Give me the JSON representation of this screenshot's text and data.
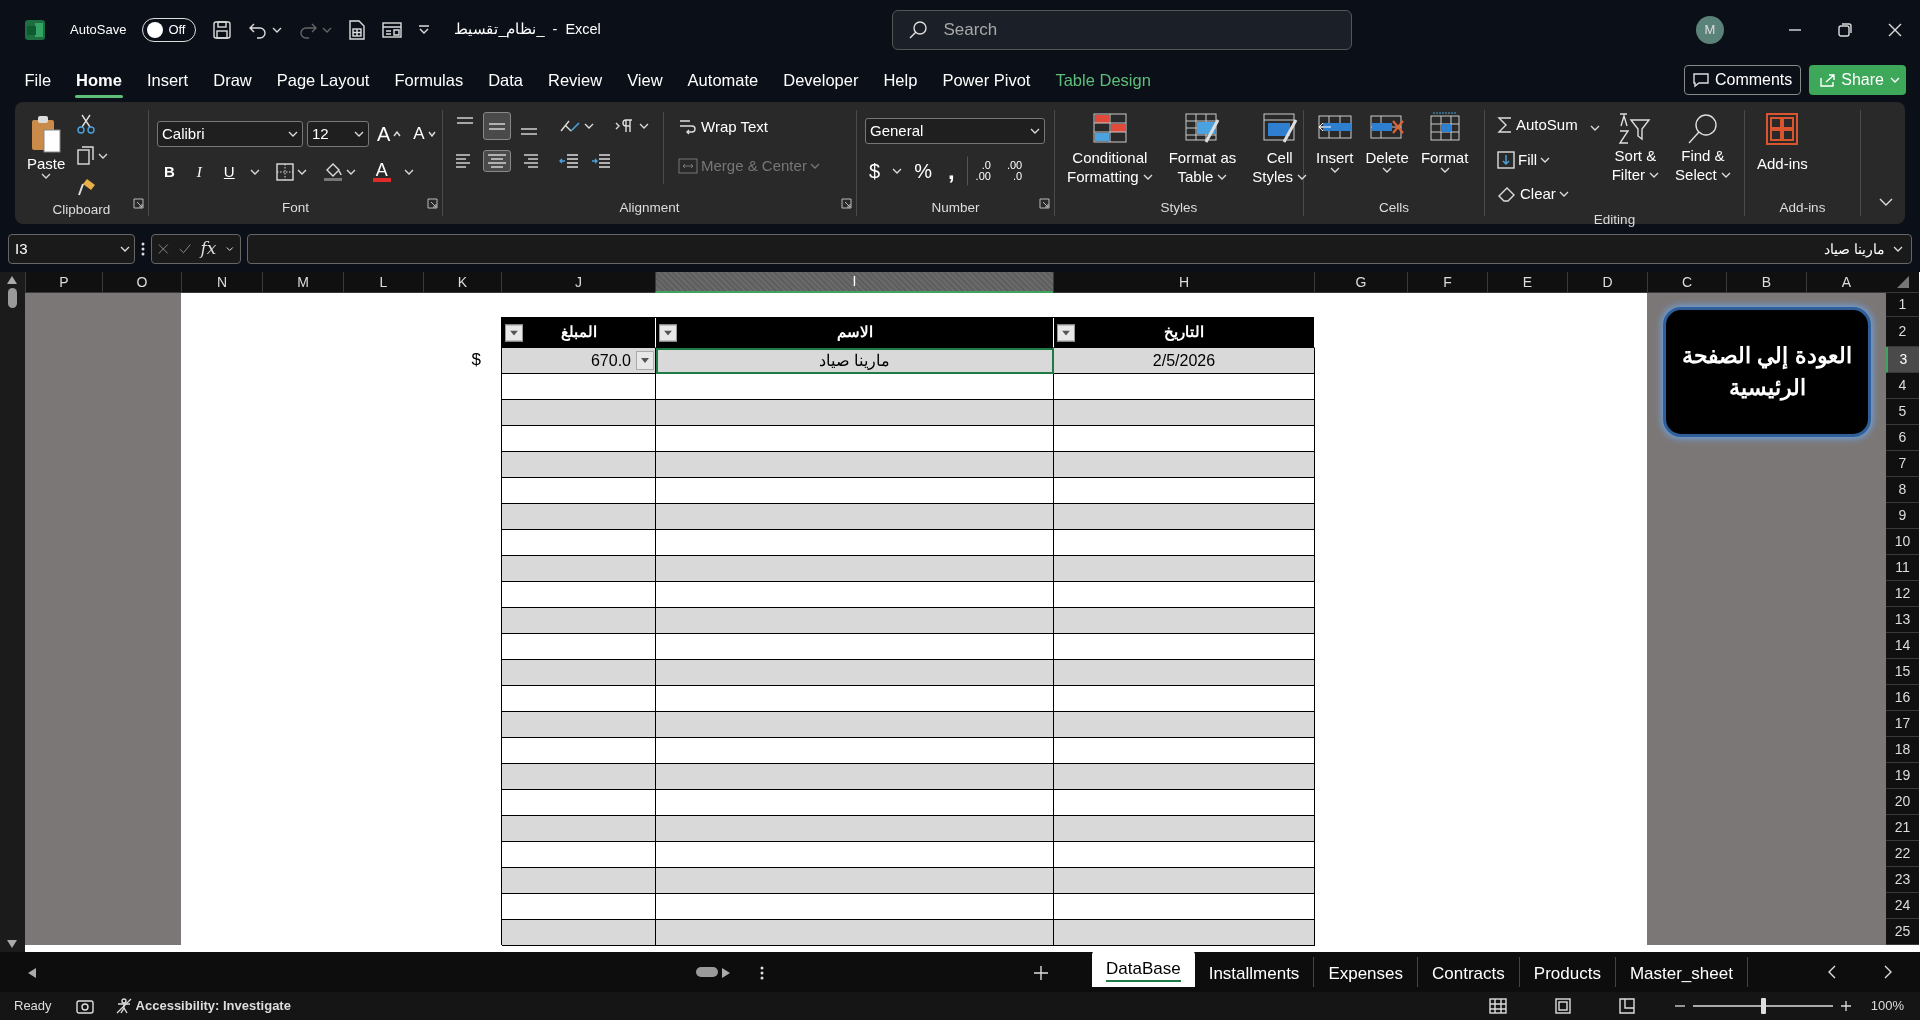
{
  "window": {
    "file_name": "نظام_تقسيط_",
    "separator": "-",
    "app": "Excel",
    "autosave": "AutoSave",
    "autosave_on": false,
    "autosave_state": "Off",
    "search_placeholder": "Search",
    "avatar": "M"
  },
  "tabs": [
    {
      "label": "File",
      "selected": false,
      "kind": "normal"
    },
    {
      "label": "Home",
      "selected": true,
      "kind": "normal"
    },
    {
      "label": "Insert",
      "selected": false,
      "kind": "normal"
    },
    {
      "label": "Draw",
      "selected": false,
      "kind": "normal"
    },
    {
      "label": "Page Layout",
      "selected": false,
      "kind": "normal"
    },
    {
      "label": "Formulas",
      "selected": false,
      "kind": "normal"
    },
    {
      "label": "Data",
      "selected": false,
      "kind": "normal"
    },
    {
      "label": "Review",
      "selected": false,
      "kind": "normal"
    },
    {
      "label": "View",
      "selected": false,
      "kind": "normal"
    },
    {
      "label": "Automate",
      "selected": false,
      "kind": "normal"
    },
    {
      "label": "Developer",
      "selected": false,
      "kind": "normal"
    },
    {
      "label": "Help",
      "selected": false,
      "kind": "normal"
    },
    {
      "label": "Power Pivot",
      "selected": false,
      "kind": "normal"
    },
    {
      "label": "Table Design",
      "selected": false,
      "kind": "contextual"
    }
  ],
  "comments": "Comments",
  "share": "Share",
  "clipboard": {
    "label": "Clipboard",
    "paste": "Paste"
  },
  "font": {
    "label": "Font",
    "font_name": "Calibri",
    "font_size": "12",
    "grow": "A",
    "shrink": "A",
    "bold": "B",
    "italic": "I",
    "underline": "U",
    "font_color": "A"
  },
  "alignment": {
    "label": "Alignment",
    "vertical_align": [
      {
        "selected": false
      },
      {
        "selected": true
      },
      {
        "selected": false
      }
    ],
    "horizontal_align": [
      {
        "selected": false
      },
      {
        "selected": true
      },
      {
        "selected": false
      }
    ],
    "wrap_text": "Wrap Text",
    "merge": "Merge & Center",
    "merge_disabled": true
  },
  "number": {
    "label": "Number",
    "format": "General",
    "currency": "$",
    "percent": "%",
    "comma": ",",
    "decimals": [
      {
        "top": ".0",
        "bottom": ".00"
      },
      {
        "top": ".00",
        "bottom": ".0"
      }
    ]
  },
  "styles": {
    "label": "Styles",
    "buttons": [
      {
        "lines": [
          "Conditional",
          "Formatting"
        ]
      },
      {
        "lines": [
          "Format as",
          "Table"
        ]
      },
      {
        "lines": [
          "Cell",
          "Styles"
        ]
      }
    ]
  },
  "cells": {
    "label": "Cells",
    "buttons": [
      "Insert",
      "Delete",
      "Format"
    ]
  },
  "editing": {
    "label": "Editing",
    "autosum": "AutoSum",
    "fill": "Fill",
    "clear": "Clear",
    "sort": [
      "Sort &",
      "Filter"
    ],
    "find": [
      "Find &",
      "Select"
    ]
  },
  "addins": {
    "label": "Add-ins",
    "button": "Add-ins"
  },
  "formula_bar": {
    "name_box": "I3",
    "fx": "fx",
    "value": "مارينا صياد"
  },
  "sheet": {
    "columns": [
      {
        "letter": "P",
        "selected": false
      },
      {
        "letter": "O",
        "selected": false
      },
      {
        "letter": "N",
        "selected": false
      },
      {
        "letter": "M",
        "selected": false
      },
      {
        "letter": "L",
        "selected": false
      },
      {
        "letter": "K",
        "selected": false
      },
      {
        "letter": "J",
        "selected": false
      },
      {
        "letter": "I",
        "selected": true
      },
      {
        "letter": "H",
        "selected": false
      },
      {
        "letter": "G",
        "selected": false
      },
      {
        "letter": "F",
        "selected": false
      },
      {
        "letter": "E",
        "selected": false
      },
      {
        "letter": "D",
        "selected": false
      },
      {
        "letter": "C",
        "selected": false
      },
      {
        "letter": "B",
        "selected": false
      },
      {
        "letter": "A",
        "selected": false
      }
    ],
    "rows": [
      {
        "number": "1",
        "selected": false
      },
      {
        "number": "2",
        "selected": false
      },
      {
        "number": "3",
        "selected": true
      },
      {
        "number": "4",
        "selected": false
      },
      {
        "number": "5",
        "selected": false
      },
      {
        "number": "6",
        "selected": false
      },
      {
        "number": "7",
        "selected": false
      },
      {
        "number": "8",
        "selected": false
      },
      {
        "number": "9",
        "selected": false
      },
      {
        "number": "10",
        "selected": false
      },
      {
        "number": "11",
        "selected": false
      },
      {
        "number": "12",
        "selected": false
      },
      {
        "number": "13",
        "selected": false
      },
      {
        "number": "14",
        "selected": false
      },
      {
        "number": "15",
        "selected": false
      },
      {
        "number": "16",
        "selected": false
      },
      {
        "number": "17",
        "selected": false
      },
      {
        "number": "18",
        "selected": false
      },
      {
        "number": "19",
        "selected": false
      },
      {
        "number": "20",
        "selected": false
      },
      {
        "number": "21",
        "selected": false
      },
      {
        "number": "22",
        "selected": false
      },
      {
        "number": "23",
        "selected": false
      },
      {
        "number": "24",
        "selected": false
      },
      {
        "number": "25",
        "selected": false
      }
    ],
    "table": {
      "columns": [
        "المبلغ",
        "الاسم",
        "التاريخ"
      ],
      "rows": [
        [
          "670.0",
          "مارينا صياد",
          "2/5/2026"
        ]
      ]
    },
    "currency_note": "$",
    "shape_button": "العودة إلي الصفحة الرئيسية"
  },
  "sheet_tabs": [
    {
      "label": "DataBase",
      "selected": true
    },
    {
      "label": "Installments",
      "selected": false
    },
    {
      "label": "Expenses",
      "selected": false
    },
    {
      "label": "Contracts",
      "selected": false
    },
    {
      "label": "Products",
      "selected": false
    },
    {
      "label": "Master_sheet",
      "selected": false
    }
  ],
  "status_bar": {
    "ready": "Ready",
    "accessibility": "Accessibility: Investigate",
    "zoom": "100%",
    "zoom_slider": {
      "level": 0.5
    }
  }
}
